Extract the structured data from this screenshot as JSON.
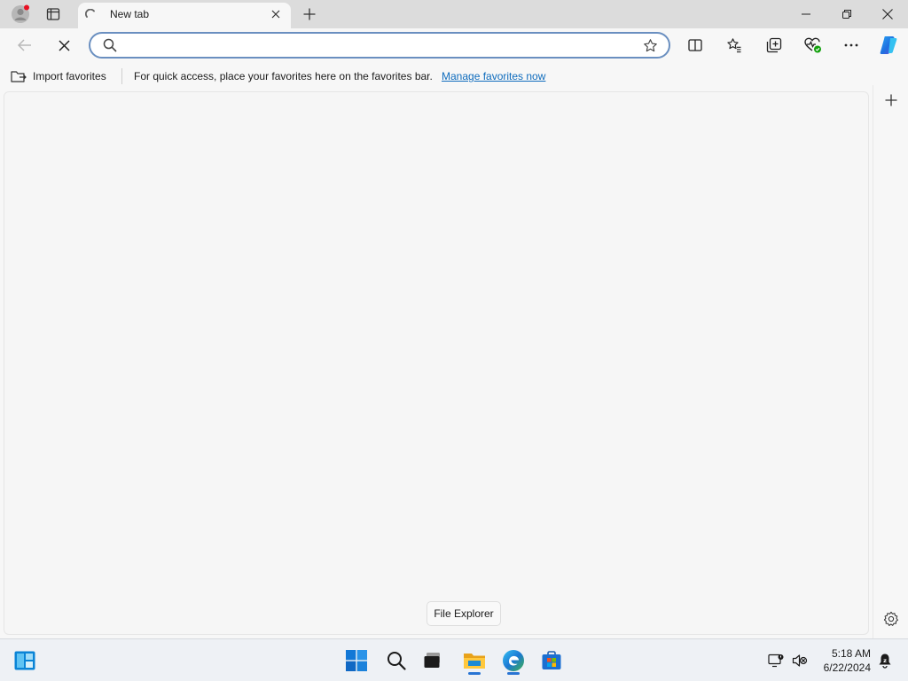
{
  "window": {
    "tab_title": "New tab",
    "address_placeholder": "",
    "address_value": ""
  },
  "favorites_bar": {
    "import_label": "Import favorites",
    "message": "For quick access, place your favorites here on the favorites bar.",
    "manage_link": "Manage favorites now"
  },
  "page": {
    "tooltip": "File Explorer"
  },
  "taskbar": {
    "time": "5:18 AM",
    "date": "6/22/2024",
    "pinned": [
      "widgets-icon",
      "start-icon",
      "search-icon",
      "task-view-icon",
      "file-explorer-icon",
      "edge-icon",
      "store-icon"
    ]
  },
  "colors": {
    "accent": "#0f6cbd",
    "address_border": "#6a8fc0",
    "notification_dot": "#e81123",
    "title_bg": "#dcdcdc",
    "page_bg": "#f6f6f6"
  }
}
